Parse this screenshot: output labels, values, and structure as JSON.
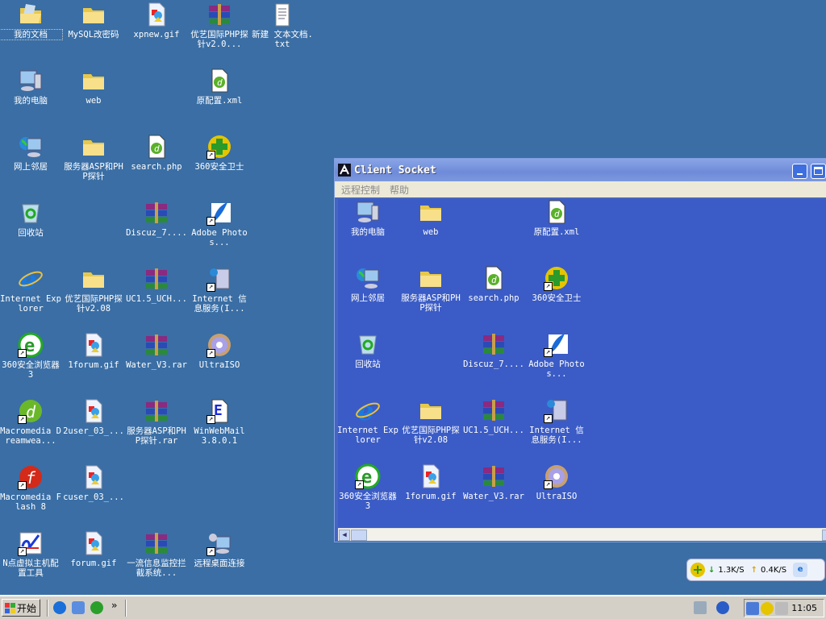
{
  "desktop": {
    "icons": [
      {
        "label": "我的文档",
        "type": "mydocs",
        "col": 0,
        "row": 0,
        "selected": true
      },
      {
        "label": "MySQL改密码",
        "type": "folder",
        "col": 1,
        "row": 0
      },
      {
        "label": "xpnew.gif",
        "type": "gif",
        "col": 2,
        "row": 0
      },
      {
        "label": "优艺国际PHP探针v2.0...",
        "type": "rar",
        "col": 3,
        "row": 0
      },
      {
        "label": "新建 文本文档.txt",
        "type": "txt",
        "col": 4,
        "row": 0
      },
      {
        "label": "我的电脑",
        "type": "computer",
        "col": 0,
        "row": 1
      },
      {
        "label": "web",
        "type": "folder",
        "col": 1,
        "row": 1
      },
      {
        "label": "原配置.xml",
        "type": "dw",
        "col": 3,
        "row": 1
      },
      {
        "label": "网上邻居",
        "type": "network",
        "col": 0,
        "row": 2
      },
      {
        "label": "服务器ASP和PHP探针",
        "type": "folder",
        "col": 1,
        "row": 2
      },
      {
        "label": "search.php",
        "type": "dw",
        "col": 2,
        "row": 2
      },
      {
        "label": "360安全卫士",
        "type": "s360",
        "col": 3,
        "row": 2,
        "shortcut": true
      },
      {
        "label": "回收站",
        "type": "recycle",
        "col": 0,
        "row": 3
      },
      {
        "label": "Discuz_7....",
        "type": "rar",
        "col": 2,
        "row": 3
      },
      {
        "label": "Adobe Photos...",
        "type": "ps",
        "col": 3,
        "row": 3,
        "shortcut": true
      },
      {
        "label": "Internet Explorer",
        "type": "ie",
        "col": 0,
        "row": 4
      },
      {
        "label": "优艺国际PHP探针v2.08",
        "type": "folder",
        "col": 1,
        "row": 4
      },
      {
        "label": "UC1.5_UCH...",
        "type": "rar",
        "col": 2,
        "row": 4
      },
      {
        "label": "Internet 信息服务(I...",
        "type": "iis",
        "col": 3,
        "row": 4,
        "shortcut": true
      },
      {
        "label": "360安全浏览器 3",
        "type": "se",
        "col": 0,
        "row": 5,
        "shortcut": true
      },
      {
        "label": "1forum.gif",
        "type": "gif",
        "col": 1,
        "row": 5
      },
      {
        "label": "Water_V3.rar",
        "type": "rar",
        "col": 2,
        "row": 5
      },
      {
        "label": "UltraISO",
        "type": "cd",
        "col": 3,
        "row": 5,
        "shortcut": true
      },
      {
        "label": "Macromedia Dreamwea...",
        "type": "dwapp",
        "col": 0,
        "row": 6,
        "shortcut": true
      },
      {
        "label": "2user_03_...",
        "type": "gif",
        "col": 1,
        "row": 6
      },
      {
        "label": "服务器ASP和PHP探针.rar",
        "type": "rar",
        "col": 2,
        "row": 6
      },
      {
        "label": "WinWebMail 3.8.0.1",
        "type": "mail",
        "col": 3,
        "row": 6,
        "shortcut": true
      },
      {
        "label": "Macromedia Flash 8",
        "type": "flash",
        "col": 0,
        "row": 7,
        "shortcut": true
      },
      {
        "label": "cuser_03_...",
        "type": "gif",
        "col": 1,
        "row": 7
      },
      {
        "label": "N点虚拟主机配置工具",
        "type": "npoint",
        "col": 0,
        "row": 8,
        "shortcut": true
      },
      {
        "label": "forum.gif",
        "type": "gif",
        "col": 1,
        "row": 8
      },
      {
        "label": "一流信息监控拦截系统...",
        "type": "rar",
        "col": 2,
        "row": 8
      },
      {
        "label": "远程桌面连接",
        "type": "rdp",
        "col": 3,
        "row": 8,
        "shortcut": true
      }
    ]
  },
  "window": {
    "title": "Client Socket",
    "menu": [
      "远程控制",
      "帮助"
    ],
    "icons": [
      {
        "label": "我的电脑",
        "type": "computer",
        "col": 0,
        "row": 0
      },
      {
        "label": "web",
        "type": "folder",
        "col": 1,
        "row": 0
      },
      {
        "label": "原配置.xml",
        "type": "dw",
        "col": 3,
        "row": 0
      },
      {
        "label": "网上邻居",
        "type": "network",
        "col": 0,
        "row": 1
      },
      {
        "label": "服务器ASP和PHP探针",
        "type": "folder",
        "col": 1,
        "row": 1
      },
      {
        "label": "search.php",
        "type": "dw",
        "col": 2,
        "row": 1
      },
      {
        "label": "360安全卫士",
        "type": "s360",
        "col": 3,
        "row": 1,
        "shortcut": true
      },
      {
        "label": "回收站",
        "type": "recycle",
        "col": 0,
        "row": 2
      },
      {
        "label": "Discuz_7....",
        "type": "rar",
        "col": 2,
        "row": 2
      },
      {
        "label": "Adobe Photos...",
        "type": "ps",
        "col": 3,
        "row": 2,
        "shortcut": true
      },
      {
        "label": "Internet Explorer",
        "type": "ie",
        "col": 0,
        "row": 3
      },
      {
        "label": "优艺国际PHP探针v2.08",
        "type": "folder",
        "col": 1,
        "row": 3
      },
      {
        "label": "UC1.5_UCH...",
        "type": "rar",
        "col": 2,
        "row": 3
      },
      {
        "label": "Internet 信息服务(I...",
        "type": "iis",
        "col": 3,
        "row": 3,
        "shortcut": true
      },
      {
        "label": "360安全浏览器 3",
        "type": "se",
        "col": 0,
        "row": 4,
        "shortcut": true
      },
      {
        "label": "1forum.gif",
        "type": "gif",
        "col": 1,
        "row": 4
      },
      {
        "label": "Water_V3.rar",
        "type": "rar",
        "col": 2,
        "row": 4
      },
      {
        "label": "UltraISO",
        "type": "cd",
        "col": 3,
        "row": 4,
        "shortcut": true
      }
    ]
  },
  "netspeed": {
    "down": "1.3K/S",
    "up": "0.4K/S"
  },
  "taskbar": {
    "start": "开始",
    "chevron": "»",
    "clock": "11:05"
  },
  "colors": {
    "desktop": "#3a6ea5",
    "window_bg": "#3b5cc6",
    "taskbar": "#d4d0c8"
  }
}
